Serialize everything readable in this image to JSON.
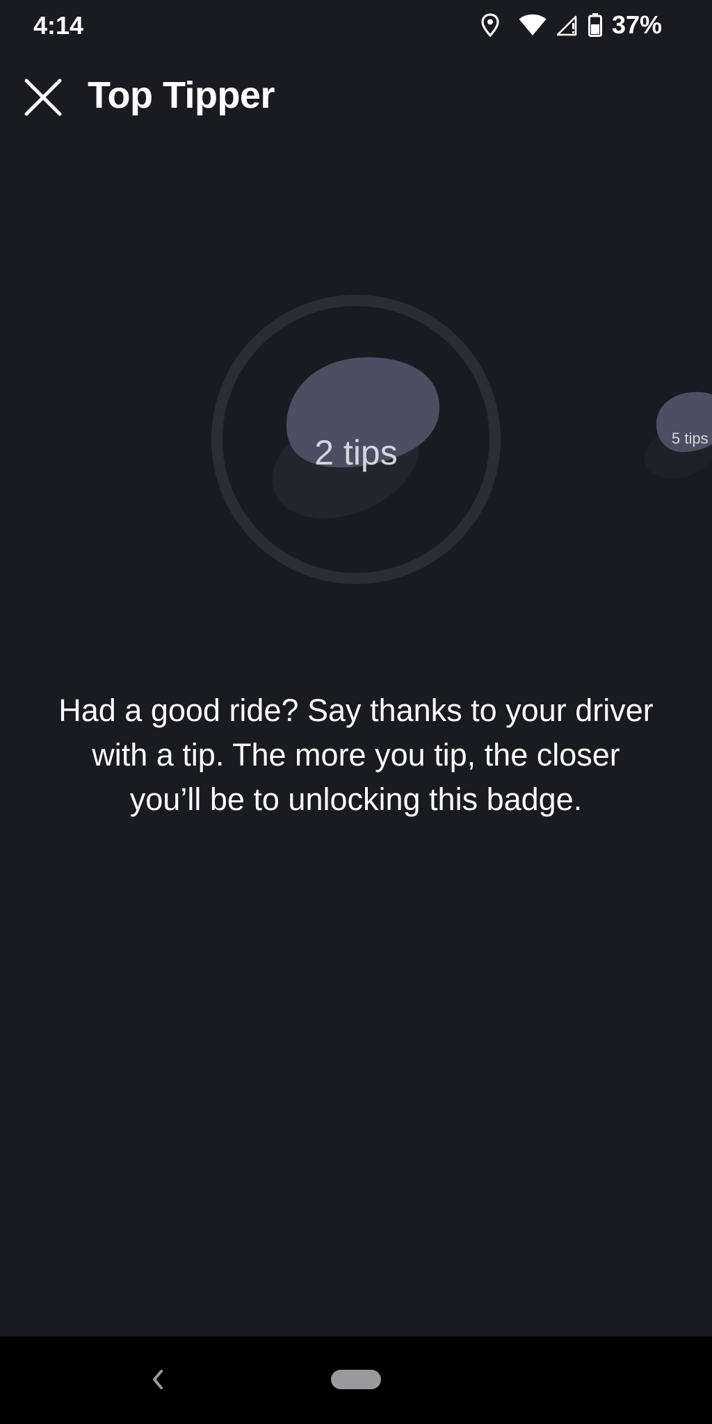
{
  "status_bar": {
    "time": "4:14",
    "battery_percent": "37%",
    "icons": [
      "location-icon",
      "wifi-icon",
      "cell-signal-icon",
      "battery-icon"
    ]
  },
  "header": {
    "title": "Top Tipper",
    "close_icon": "close-icon"
  },
  "badges": {
    "current_label": "2 tips",
    "next_label": "5 tips"
  },
  "description": "Had a good ride? Say thanks to your driver with a tip. The more you tip, the closer you’ll be to unlocking this badge.",
  "nav_bar": {
    "back_icon": "back-chevron-icon",
    "home_icon": "home-pill-icon"
  },
  "colors": {
    "background": "#1a1a21",
    "badge_ring": "#2c2c36",
    "badge_blob": "#4e4e63",
    "badge_shadow": "#24242d",
    "nav_bar": "#000000"
  }
}
